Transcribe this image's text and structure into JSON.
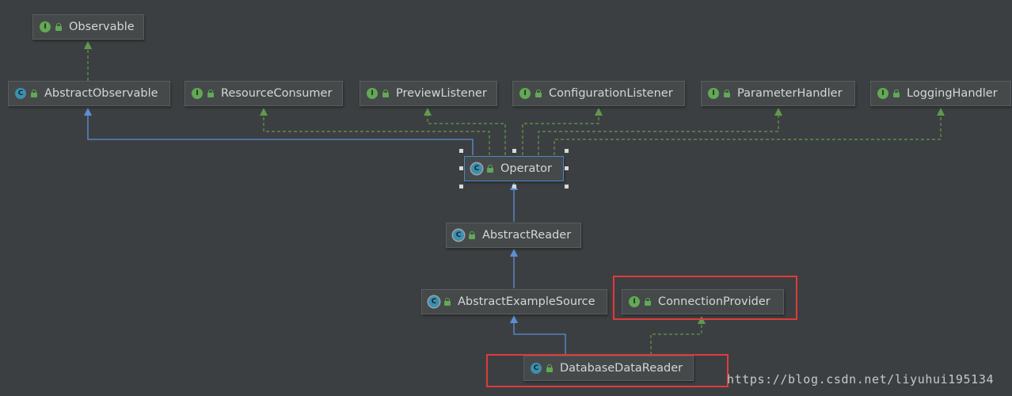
{
  "diagram": {
    "nodes": {
      "observable": {
        "label": "Observable",
        "kind": "I"
      },
      "abstract_observable": {
        "label": "AbstractObservable",
        "kind": "C"
      },
      "resource_consumer": {
        "label": "ResourceConsumer",
        "kind": "I"
      },
      "preview_listener": {
        "label": "PreviewListener",
        "kind": "I"
      },
      "configuration_listener": {
        "label": "ConfigurationListener",
        "kind": "I"
      },
      "parameter_handler": {
        "label": "ParameterHandler",
        "kind": "I"
      },
      "logging_handler": {
        "label": "LoggingHandler",
        "kind": "I"
      },
      "operator": {
        "label": "Operator",
        "kind": "C"
      },
      "abstract_reader": {
        "label": "AbstractReader",
        "kind": "C"
      },
      "abstract_example_source": {
        "label": "AbstractExampleSource",
        "kind": "C"
      },
      "connection_provider": {
        "label": "ConnectionProvider",
        "kind": "I"
      },
      "database_data_reader": {
        "label": "DatabaseDataReader",
        "kind": "C"
      }
    },
    "relations": [
      {
        "from": "Operator",
        "to": "AbstractObservable",
        "type": "extends"
      },
      {
        "from": "Operator",
        "to": "ResourceConsumer",
        "type": "implements"
      },
      {
        "from": "Operator",
        "to": "PreviewListener",
        "type": "implements"
      },
      {
        "from": "Operator",
        "to": "ConfigurationListener",
        "type": "implements"
      },
      {
        "from": "Operator",
        "to": "ParameterHandler",
        "type": "implements"
      },
      {
        "from": "Operator",
        "to": "LoggingHandler",
        "type": "implements"
      },
      {
        "from": "AbstractObservable",
        "to": "Observable",
        "type": "implements"
      },
      {
        "from": "AbstractReader",
        "to": "Operator",
        "type": "extends"
      },
      {
        "from": "AbstractExampleSource",
        "to": "AbstractReader",
        "type": "extends"
      },
      {
        "from": "DatabaseDataReader",
        "to": "AbstractExampleSource",
        "type": "extends"
      },
      {
        "from": "DatabaseDataReader",
        "to": "ConnectionProvider",
        "type": "implements"
      }
    ],
    "colors": {
      "extends": "#5a8fd6",
      "implements": "#5f9a4c",
      "highlight": "#e03a3a"
    }
  },
  "watermark": "https://blog.csdn.net/liyuhui195134"
}
